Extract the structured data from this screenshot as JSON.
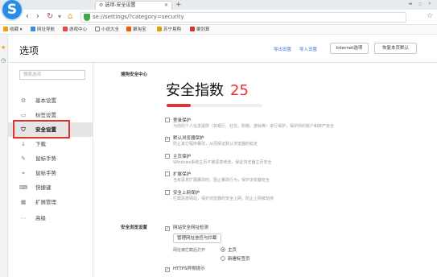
{
  "browser": {
    "tab_title": "选项-安全设置",
    "url": "se://settings/?category=security"
  },
  "bookmarks": [
    {
      "label": "收藏",
      "color": "#f0a300"
    },
    {
      "label": "网址导航",
      "color": "#3b8be0"
    },
    {
      "label": "游戏中心",
      "color": "#e94545"
    },
    {
      "label": "小说大全",
      "color": "#777777"
    },
    {
      "label": "聚淘宝",
      "color": "#ff5500"
    },
    {
      "label": "苏宁易购",
      "color": "#e0a000"
    },
    {
      "label": "聚划算",
      "color": "#e02e2e"
    }
  ],
  "page": {
    "title": "选项",
    "header_links": [
      "导出设置",
      "导入设置"
    ],
    "header_buttons": [
      "Internet选项",
      "恢复本页默认"
    ]
  },
  "sidebar": {
    "search_placeholder": "搜索选项",
    "items": [
      {
        "label": "基本设置",
        "icon": "gear-icon",
        "glyph": "⚙"
      },
      {
        "label": "标签设置",
        "icon": "tab-icon",
        "glyph": "▭"
      },
      {
        "label": "安全设置",
        "icon": "shield-icon",
        "glyph": "⛉"
      },
      {
        "label": "下载",
        "icon": "download-icon",
        "glyph": "↓"
      },
      {
        "label": "鼠标手势",
        "icon": "mouse-gesture-icon",
        "glyph": "✎"
      },
      {
        "label": "鼠标手势",
        "icon": "cursor-icon",
        "glyph": "⌖"
      },
      {
        "label": "快捷键",
        "icon": "keyboard-icon",
        "glyph": "⌨"
      },
      {
        "label": "扩展管理",
        "icon": "extension-icon",
        "glyph": "▦"
      },
      {
        "label": "高级",
        "icon": "advanced-icon",
        "glyph": "⋯"
      }
    ],
    "active_index": 2
  },
  "security": {
    "section_title": "搜狗安全中心",
    "index_label": "安全指数",
    "index_value": "25",
    "index_fraction": 0.25,
    "options": [
      {
        "label": "登录保护",
        "checked": false,
        "desc": "为你的个人信息提供（如银行、社交、购物、游戏等）进行保护，保护你的账户和财产安全"
      },
      {
        "label": "默认浏览器保护",
        "checked": true,
        "desc": "防止其它程序篡改，从而保证默认浏览器的稳定"
      },
      {
        "label": "主页保护",
        "checked": false,
        "desc": "Windows系统主页不被恶意修改，保证浏览器主页安全"
      },
      {
        "label": "扩展保护",
        "checked": false,
        "desc": "当有恶意扩展篡改时，阻止篡改行为，保护浏览器安全"
      },
      {
        "label": "安全上网保护",
        "checked": false,
        "desc": "拦截恶意网站，保护浏览器的安全上网，防止上网被劫持"
      }
    ],
    "browse_section_title": "安全浏览设置",
    "browse_option": {
      "label": "网站安全网址检测",
      "checked": true
    },
    "manage_button": "管理网址信任与拦截",
    "open_label": "网址被拦截后打开",
    "radios": [
      {
        "label": "主页",
        "selected": true
      },
      {
        "label": "新建标签页",
        "selected": false
      }
    ],
    "https_option": {
      "label": "HTTPS异常提示",
      "checked": true
    }
  }
}
